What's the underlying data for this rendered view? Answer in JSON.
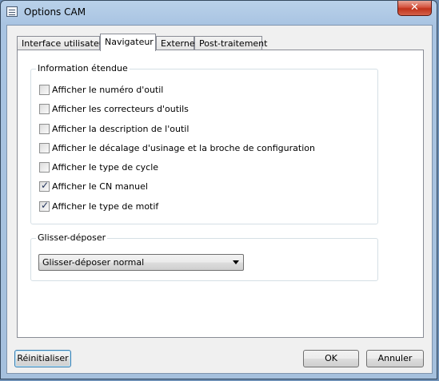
{
  "window": {
    "title": "Options CAM",
    "close_symbol": "✕"
  },
  "tabs": [
    {
      "label": "Interface utilisateur",
      "active": false
    },
    {
      "label": "Navigateur",
      "active": true
    },
    {
      "label": "Externe",
      "active": false
    },
    {
      "label": "Post-traitement",
      "active": false
    }
  ],
  "extended_info": {
    "title": "Information étendue",
    "options": [
      {
        "label": "Afficher le numéro d'outil",
        "checked": false
      },
      {
        "label": "Afficher les correcteurs d'outils",
        "checked": false
      },
      {
        "label": "Afficher la description de l'outil",
        "checked": false
      },
      {
        "label": "Afficher le décalage d'usinage et la broche de configuration",
        "checked": false
      },
      {
        "label": "Afficher le type de cycle",
        "checked": false
      },
      {
        "label": "Afficher le CN manuel",
        "checked": true
      },
      {
        "label": "Afficher le type de motif",
        "checked": true
      }
    ]
  },
  "drag_drop": {
    "title": "Glisser-déposer",
    "selected": "Glisser-déposer normal"
  },
  "buttons": {
    "reset": "Réinitialiser",
    "ok": "OK",
    "cancel": "Annuler"
  },
  "icons": {
    "app": "window-list-icon",
    "close": "close-icon",
    "dropdown": "chevron-down-icon"
  }
}
